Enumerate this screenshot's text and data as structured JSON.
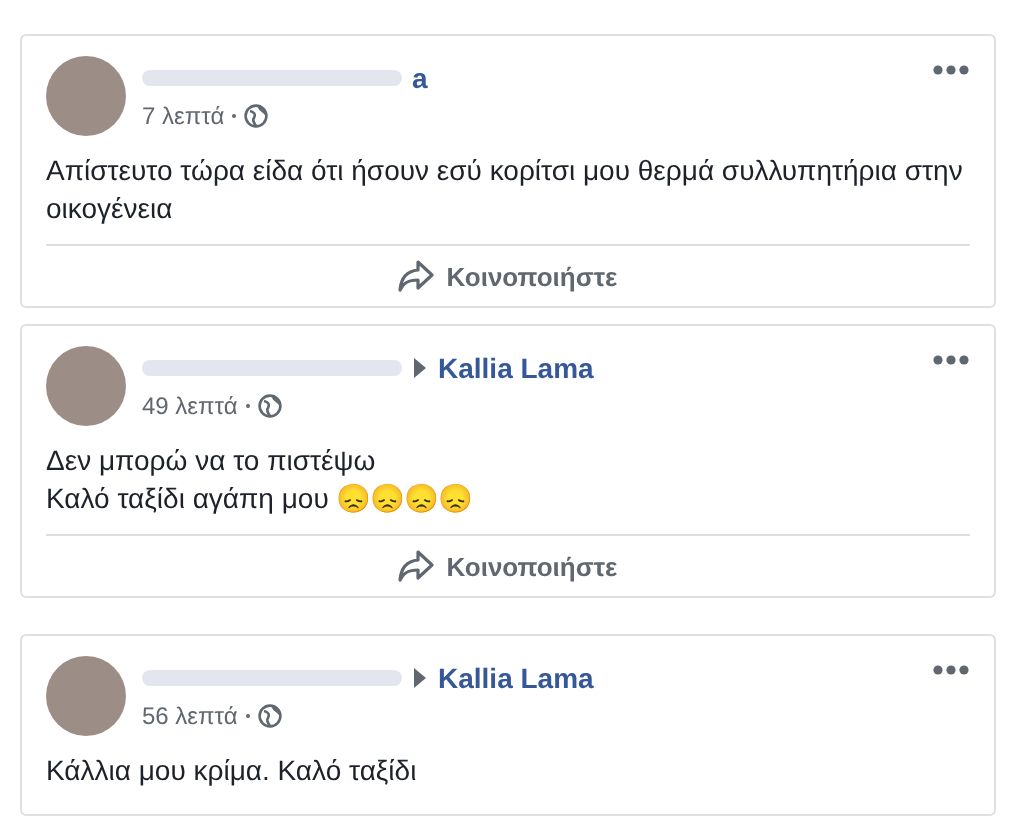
{
  "posts": [
    {
      "author": "a",
      "time": "7 λεπτά",
      "body": [
        "Απίστευτο τώρα είδα ότι ήσουν εσύ κορίτσι μου θερμά συλλυπητήρια στην οικογένεια"
      ],
      "share": "Κοινοποιήστε"
    },
    {
      "target": "Kallia Lama",
      "time": "49 λεπτά",
      "body": [
        "Δεν μπορώ να το πιστέψω",
        "Καλό ταξίδι αγάπη μου 😞😞😞😞"
      ],
      "share": "Κοινοποιήστε"
    },
    {
      "target": "Kallia Lama",
      "time": "56 λεπτά",
      "body": [
        "Κάλλια μου κρίμα. Καλό ταξίδι"
      ]
    }
  ]
}
